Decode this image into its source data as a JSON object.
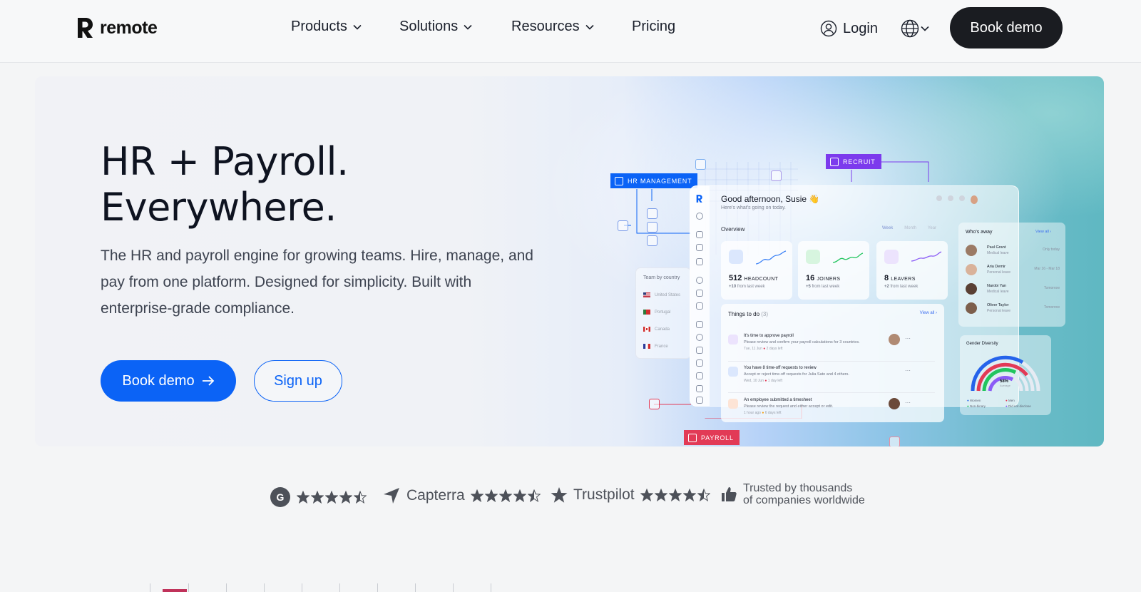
{
  "nav": {
    "logo_text": "remote",
    "links": [
      {
        "label": "Products",
        "has_dropdown": true
      },
      {
        "label": "Solutions",
        "has_dropdown": true
      },
      {
        "label": "Resources",
        "has_dropdown": true
      },
      {
        "label": "Pricing",
        "has_dropdown": false
      }
    ],
    "login_label": "Login",
    "book_demo_label": "Book demo"
  },
  "hero": {
    "headline_line1": "HR + Payroll.",
    "headline_line2": "Everywhere.",
    "subtext": "The HR and payroll engine for growing teams. Hire, manage, and pay from one platform. Designed for simplicity. Built with enterprise-grade compliance.",
    "primary_cta": "Book demo",
    "secondary_cta": "Sign up"
  },
  "dashboard": {
    "tags": {
      "hr": "HR MANAGEMENT",
      "recruit": "RECRUIT",
      "payroll": "PAYROLL"
    },
    "greeting": "Good afternoon, Susie 👋",
    "greeting_sub": "Here's what's going on today.",
    "overview_title": "Overview",
    "overview_tabs": [
      "Week",
      "Month",
      "Year"
    ],
    "stats": [
      {
        "value": "512",
        "label": "HEADCOUNT",
        "delta": "+10",
        "delta_text": "from last week",
        "color": "#2563eb"
      },
      {
        "value": "16",
        "label": "JOINERS",
        "delta": "+5",
        "delta_text": "from last week",
        "color": "#22c55e"
      },
      {
        "value": "8",
        "label": "LEAVERS",
        "delta": "+2",
        "delta_text": "from last week",
        "color": "#8b5cf6"
      }
    ],
    "todo": {
      "title": "Things to do",
      "count": "(3)",
      "view_all": "View all ›",
      "items": [
        {
          "title": "It's time to approve payroll",
          "subtitle": "Please review and confirm your payroll calculations for 3 countries.",
          "meta": "Tue, 11 Jun",
          "due": "2 days left"
        },
        {
          "title": "You have 8 time-off requests to review",
          "subtitle": "Accept or reject time-off requests for Julia Sato and 4 others.",
          "meta": "Wed, 10 Jun",
          "due": "1 day left"
        },
        {
          "title": "An employee submitted a timesheet",
          "subtitle": "Please review the request and either accept or edit.",
          "meta": "1 hour ago",
          "due": "6 days left"
        }
      ]
    },
    "away": {
      "title": "Who's away",
      "view_all": "View all ›",
      "people": [
        {
          "name": "Paul Grant",
          "reason": "Medical leave",
          "date": "Only today"
        },
        {
          "name": "Aria Demir",
          "reason": "Personal leave",
          "date": "Mar 16 - Mar 18"
        },
        {
          "name": "Narobi Yan",
          "reason": "Medical leave",
          "date": "Tomorrow"
        },
        {
          "name": "Oliver Taylor",
          "reason": "Personal leave",
          "date": "Tomorrow"
        }
      ]
    },
    "gender": {
      "title": "Gender Diversity",
      "percent": "58%",
      "percent_label": "Average",
      "legend": [
        "Women",
        "Men",
        "Non-binary",
        "Did not disclose"
      ]
    },
    "country": {
      "title": "Team by country",
      "rows": [
        "United States",
        "Portugal",
        "Canada",
        "France"
      ]
    }
  },
  "ratings": {
    "g2_stars": 4.5,
    "capterra_label": "Capterra",
    "capterra_stars": 4.5,
    "trustpilot_label": "Trustpilot",
    "trustpilot_stars": 4.5,
    "trusted_line1": "Trusted by thousands",
    "trusted_line2": "of companies worldwide"
  }
}
